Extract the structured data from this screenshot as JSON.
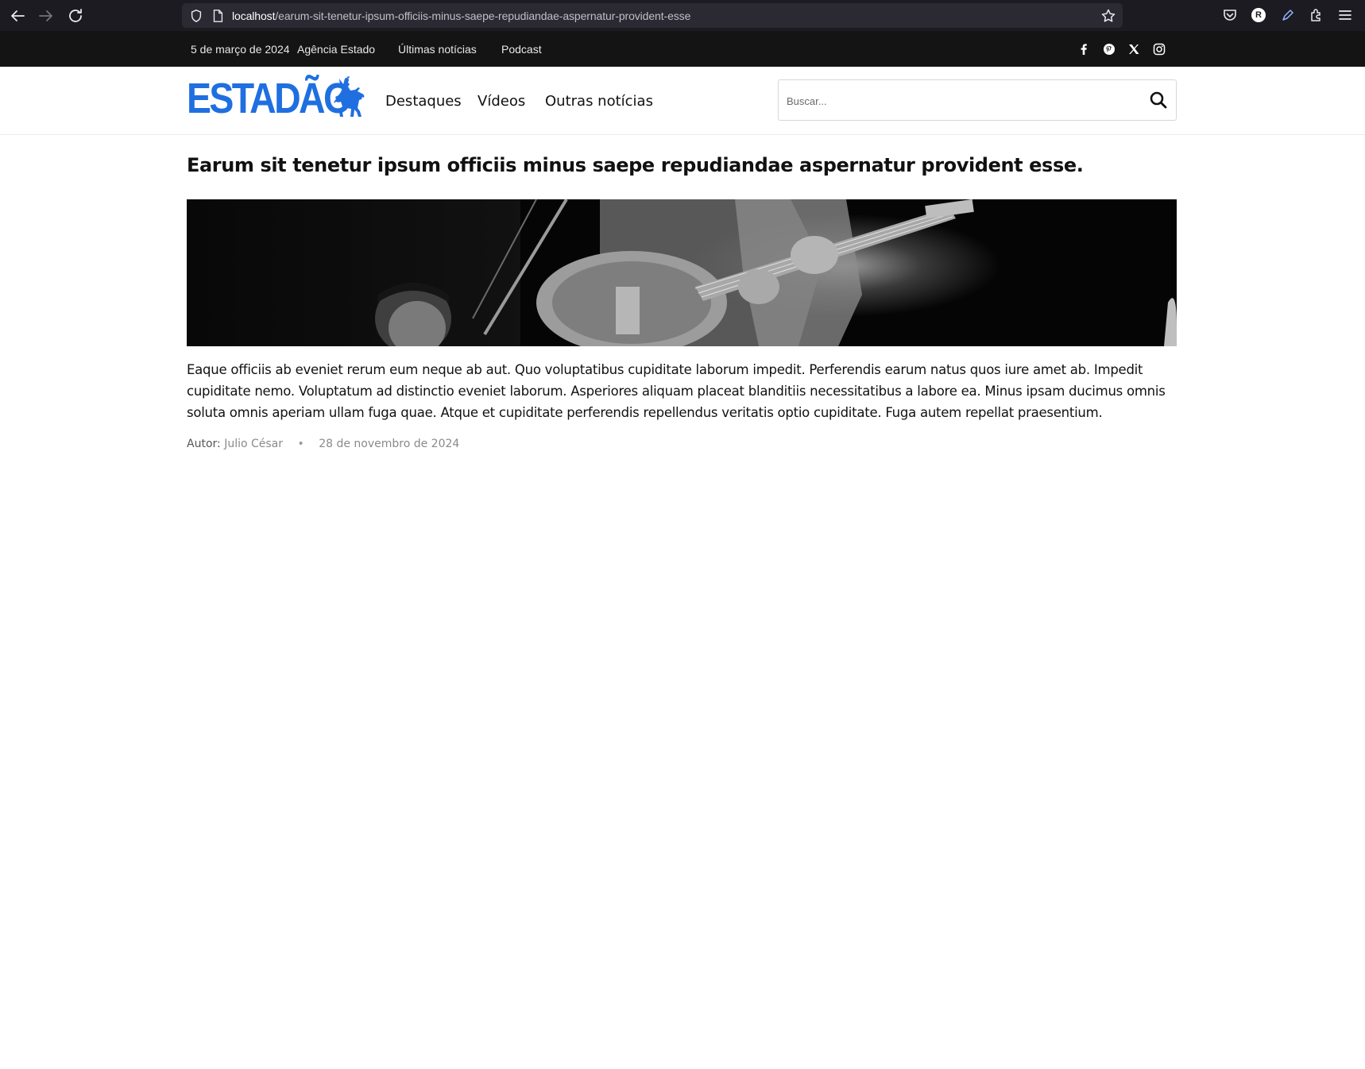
{
  "browser": {
    "url_host": "localhost",
    "url_path": "/earum-sit-tenetur-ipsum-officiis-minus-saepe-repudiandae-aspernatur-provident-esse",
    "profile_initial": "R"
  },
  "topbar": {
    "date": "5 de março de 2024",
    "links": [
      "Agência Estado",
      "Últimas notícias",
      "Podcast"
    ],
    "social_icons": [
      "facebook-icon",
      "pinterest-icon",
      "x-icon",
      "instagram-icon"
    ]
  },
  "header": {
    "logo_text": "ESTADÃO",
    "nav": [
      "Destaques",
      "Vídeos",
      "Outras notícias"
    ],
    "search_placeholder": "Buscar..."
  },
  "article": {
    "title": "Earum sit tenetur ipsum officiis minus saepe repudiandae aspernatur provident esse.",
    "body": "Eaque officiis ab eveniet rerum eum neque ab aut. Quo voluptatibus cupiditate laborum impedit. Perferendis earum natus quos iure amet ab. Impedit cupiditate nemo. Voluptatum ad distinctio eveniet laborum. Asperiores aliquam placeat blanditiis necessitatibus a labore ea. Minus ipsam ducimus omnis soluta omnis aperiam ullam fuga quae. Atque et cupiditate perferendis repellendus veritatis optio cupiditate. Fuga autem repellat praesentium.",
    "author_label": "Autor:",
    "author": "Julio César",
    "date": "28 de novembro de 2024"
  },
  "colors": {
    "brand": "#1f6fe0",
    "topbar_bg": "#141414",
    "browser_bg": "#1c1b22"
  }
}
